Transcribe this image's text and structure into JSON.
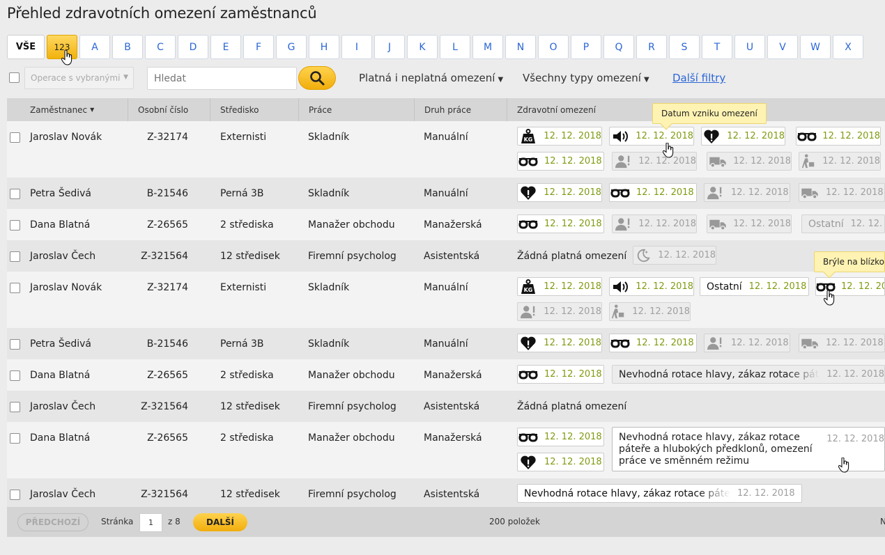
{
  "title": "Přehled zdravotních omezení zaměstnanců",
  "letters": [
    "VŠE",
    "123",
    "A",
    "B",
    "C",
    "D",
    "E",
    "F",
    "G",
    "H",
    "I",
    "J",
    "K",
    "L",
    "M",
    "N",
    "O",
    "P",
    "Q",
    "R",
    "S",
    "T",
    "U",
    "V",
    "W",
    "X"
  ],
  "toolbar": {
    "operations": "Operace s vybranými",
    "search_placeholder": "Hledat",
    "validity_filter": "Platná i neplatná omezení",
    "type_filter": "Všechny typy omezení",
    "more_filters": "Další filtry"
  },
  "columns": [
    "Zaměstnanec",
    "Osobní číslo",
    "Středisko",
    "Práce",
    "Druh práce",
    "Zdravotní omezení"
  ],
  "tooltips": {
    "created": "Datum vzniku omezení",
    "glasses": "Brýle na blízko"
  },
  "other_label": "Ostatní",
  "no_restriction": "Žádná platná omezení",
  "long_restriction": "Nevhodná rotace hlavy, zákaz rotace páteře",
  "long_restriction_full": "Nevhodná rotace hlavy, zákaz rotace páteře a hlubokých předklonů, omezení práce ve směnném režimu",
  "date": "12. 12. 2018",
  "rows": [
    {
      "name": "Jaroslav Novák",
      "num": "Z-32174",
      "center": "Externisti",
      "work": "Skladník",
      "type": "Manuální"
    },
    {
      "name": "Petra Šedivá",
      "num": "B-21546",
      "center": "Perná 3B",
      "work": "Skladník",
      "type": "Manuální"
    },
    {
      "name": "Dana Blatná",
      "num": "Z-26565",
      "center": "2 střediska",
      "work": "Manažer obchodu",
      "type": "Manažerská"
    },
    {
      "name": "Jaroslav Čech",
      "num": "Z-321564",
      "center": "12 středisek",
      "work": "Firemní psycholog",
      "type": "Asistentská"
    },
    {
      "name": "Jaroslav Novák",
      "num": "Z-32174",
      "center": "Externisti",
      "work": "Skladník",
      "type": "Manuální"
    },
    {
      "name": "Petra Šedivá",
      "num": "B-21546",
      "center": "Perná 3B",
      "work": "Skladník",
      "type": "Manuální"
    },
    {
      "name": "Dana Blatná",
      "num": "Z-26565",
      "center": "2 střediska",
      "work": "Manažer obchodu",
      "type": "Manažerská"
    },
    {
      "name": "Jaroslav Čech",
      "num": "Z-321564",
      "center": "12 středisek",
      "work": "Firemní psycholog",
      "type": "Asistentská"
    },
    {
      "name": "Dana Blatná",
      "num": "Z-26565",
      "center": "2 střediska",
      "work": "Manažer obchodu",
      "type": "Manažerská"
    },
    {
      "name": "Jaroslav Čech",
      "num": "Z-321564",
      "center": "12 středisek",
      "work": "Firemní psycholog",
      "type": "Asistentská"
    }
  ],
  "pager": {
    "prev": "PŘEDCHOZÍ",
    "page_label": "Stránka",
    "page": "1",
    "of": "z 8",
    "next": "DALŠÍ",
    "count": "200 položek",
    "edge": "N"
  },
  "colors": {
    "accent": "#f1b20c",
    "link": "#2a66d6",
    "date_active": "#7f9b11",
    "date_inactive": "#a0a0a0"
  }
}
